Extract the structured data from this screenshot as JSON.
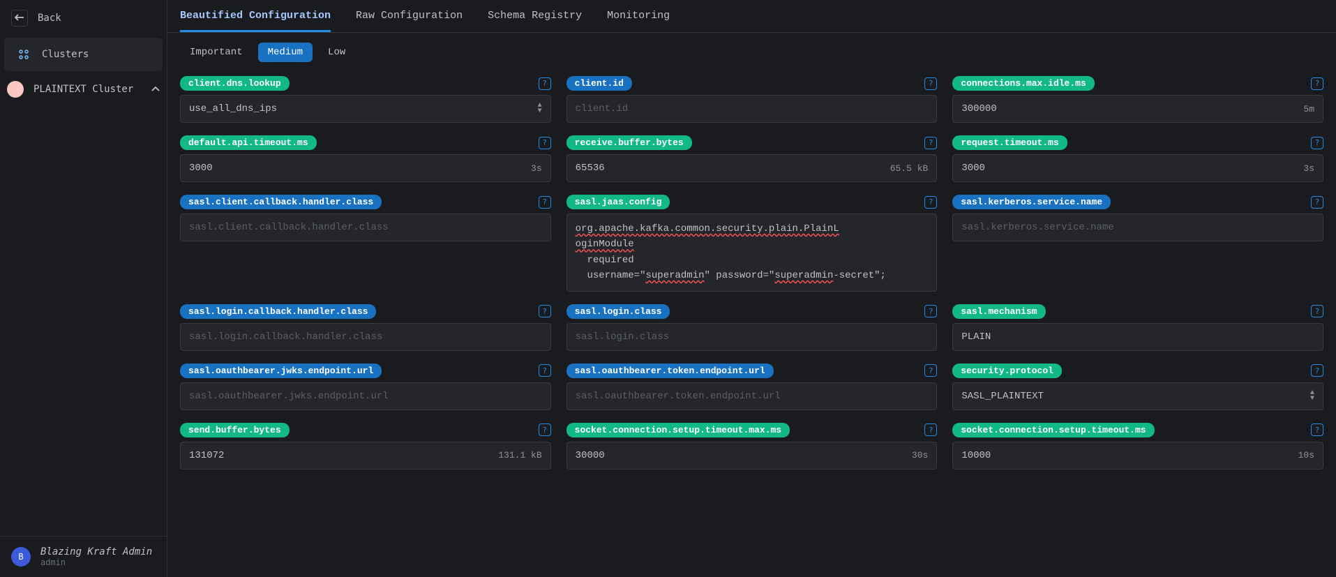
{
  "sidebar": {
    "back_label": "Back",
    "clusters_label": "Clusters",
    "cluster_name": "PLAINTEXT Cluster"
  },
  "user": {
    "initial": "B",
    "name": "Blazing Kraft Admin",
    "role": "admin"
  },
  "tabs": [
    {
      "label": "Beautified Configuration",
      "active": true
    },
    {
      "label": "Raw Configuration",
      "active": false
    },
    {
      "label": "Schema Registry",
      "active": false
    },
    {
      "label": "Monitoring",
      "active": false
    }
  ],
  "filters": [
    {
      "label": "Important",
      "selected": false
    },
    {
      "label": "Medium",
      "selected": true
    },
    {
      "label": "Low",
      "selected": false
    }
  ],
  "jaas": {
    "line1a": "org.apache.kafka.common.security.plain.PlainL",
    "line1b": "oginModule",
    "line2": "required",
    "line3a": "username=\"",
    "line3b": "superadmin",
    "line3c": "\" password=\"",
    "line3d": "superadmin",
    "line3e": "-secret\";"
  },
  "configs": [
    {
      "key": "client.dns.lookup",
      "value": "use_all_dns_ips",
      "type": "select",
      "teal": true
    },
    {
      "key": "client.id",
      "value": "",
      "placeholder": "client.id",
      "type": "text"
    },
    {
      "key": "connections.max.idle.ms",
      "value": "300000",
      "suffix": "5m",
      "type": "text",
      "teal": true
    },
    {
      "key": "default.api.timeout.ms",
      "value": "3000",
      "suffix": "3s",
      "type": "text",
      "teal": true
    },
    {
      "key": "receive.buffer.bytes",
      "value": "65536",
      "suffix": "65.5 kB",
      "type": "text",
      "teal": true
    },
    {
      "key": "request.timeout.ms",
      "value": "3000",
      "suffix": "3s",
      "type": "text",
      "teal": true
    },
    {
      "key": "sasl.client.callback.handler.class",
      "value": "",
      "placeholder": "sasl.client.callback.handler.class",
      "type": "text"
    },
    {
      "key": "sasl.jaas.config",
      "type": "jaas",
      "teal": true
    },
    {
      "key": "sasl.kerberos.service.name",
      "value": "",
      "placeholder": "sasl.kerberos.service.name",
      "type": "text"
    },
    {
      "key": "sasl.login.callback.handler.class",
      "value": "",
      "placeholder": "sasl.login.callback.handler.class",
      "type": "text"
    },
    {
      "key": "sasl.login.class",
      "value": "",
      "placeholder": "sasl.login.class",
      "type": "text"
    },
    {
      "key": "sasl.mechanism",
      "value": "PLAIN",
      "type": "text",
      "teal": true
    },
    {
      "key": "sasl.oauthbearer.jwks.endpoint.url",
      "value": "",
      "placeholder": "sasl.oauthbearer.jwks.endpoint.url",
      "type": "text"
    },
    {
      "key": "sasl.oauthbearer.token.endpoint.url",
      "value": "",
      "placeholder": "sasl.oauthbearer.token.endpoint.url",
      "type": "text"
    },
    {
      "key": "security.protocol",
      "value": "SASL_PLAINTEXT",
      "type": "select",
      "teal": true
    },
    {
      "key": "send.buffer.bytes",
      "value": "131072",
      "suffix": "131.1 kB",
      "type": "text",
      "teal": true
    },
    {
      "key": "socket.connection.setup.timeout.max.ms",
      "value": "30000",
      "suffix": "30s",
      "type": "text",
      "teal": true
    },
    {
      "key": "socket.connection.setup.timeout.ms",
      "value": "10000",
      "suffix": "10s",
      "type": "text",
      "teal": true
    }
  ]
}
